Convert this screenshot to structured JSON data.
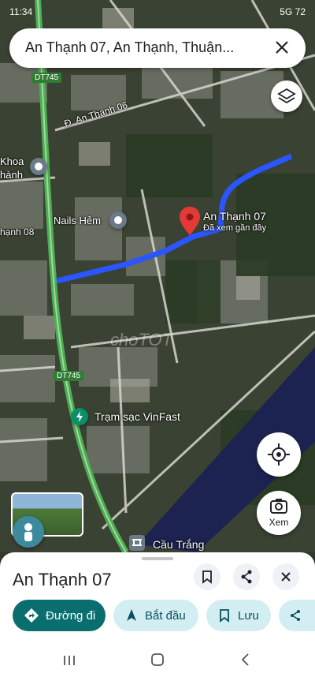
{
  "status": {
    "time": "11:34",
    "right": "5G 72"
  },
  "search": {
    "query": "An Thạnh 07, An Thạnh, Thuận..."
  },
  "map": {
    "road_labels": {
      "dt745_top": "DT745",
      "dt745_mid": "DT745",
      "an_thanh_06": "Đ. An Thạnh 06",
      "an_thanh_08": "hạnh 08"
    },
    "places": {
      "khoa": "Khoa",
      "hanh": "hành",
      "nails": "Nails Hẻm",
      "selected_name": "An Thạnh 07",
      "selected_sub": "Đã xem gần đây",
      "vinfast": "Trạm sạc VinFast",
      "cau_trang": "Cầu Trắng"
    },
    "watermark": "choTOT",
    "route_color": "#2a55ff",
    "water_color": "#1c2350",
    "highway_color": "#4caf50"
  },
  "buttons": {
    "xem": "Xem"
  },
  "sheet": {
    "title": "An Thạnh 07",
    "chips": [
      "Đường đi",
      "Bắt đầu",
      "Lưu"
    ]
  }
}
